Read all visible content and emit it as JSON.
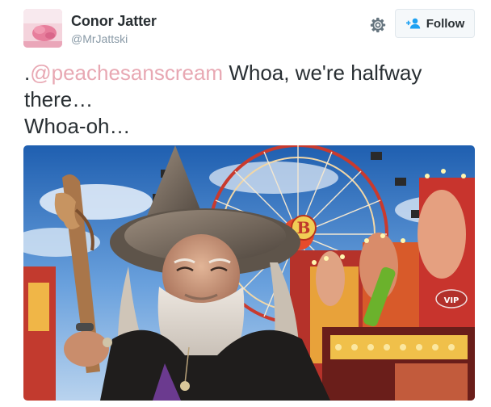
{
  "user": {
    "display_name": "Conor Jatter",
    "handle": "@MrJattski",
    "avatar_icon": "avatar-photo"
  },
  "actions": {
    "settings_icon": "gear-icon",
    "follow_icon": "add-user-icon",
    "follow_label": "Follow"
  },
  "tweet": {
    "prefix": ".",
    "mention": "@peachesanscream",
    "line1_rest": " Whoa, we're halfway",
    "line2": "there…",
    "line3": "Whoa-oh…"
  },
  "media": {
    "sign_letter": "B",
    "vip_label": "VIP"
  },
  "colors": {
    "mention": "#e8a8b3",
    "text": "#292f33",
    "muted": "#8899a6",
    "button_bg": "#f5f8fa",
    "button_border": "#e1e8ed"
  }
}
